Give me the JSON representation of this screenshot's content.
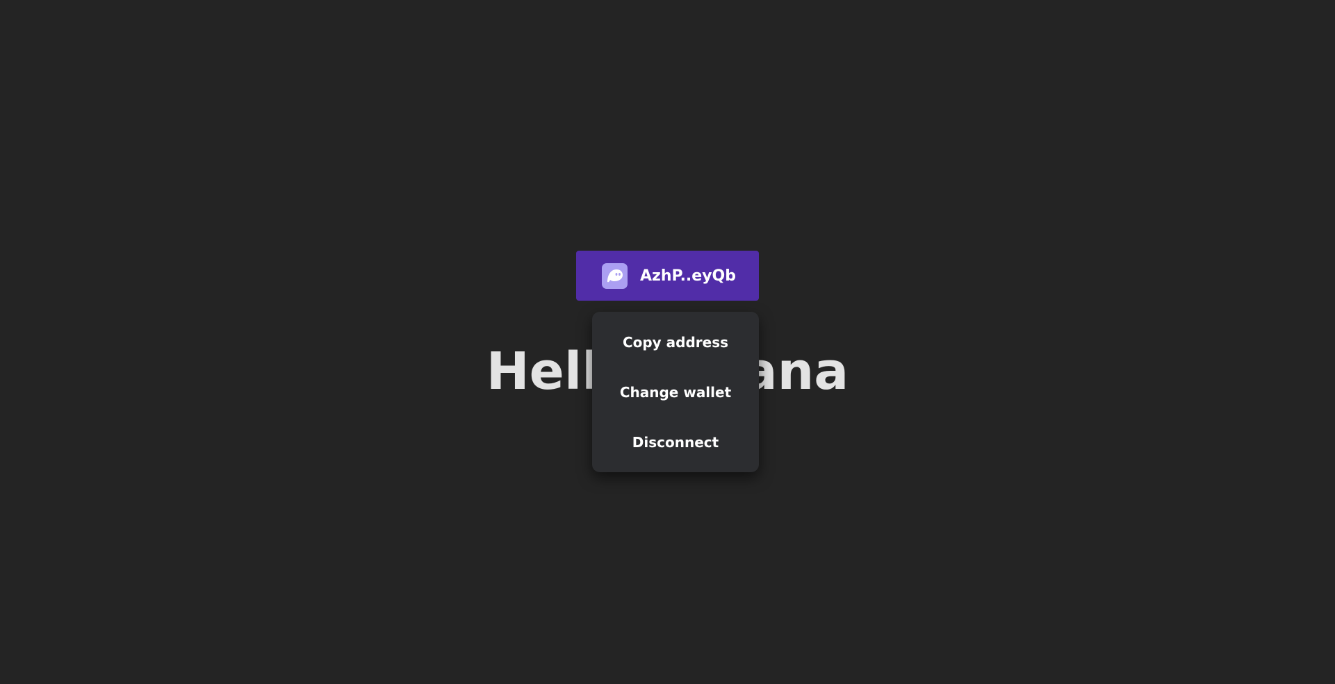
{
  "heading": {
    "text": "Hello Solana"
  },
  "wallet_button": {
    "icon": "phantom-ghost-icon",
    "address": "AzhP..eyQb"
  },
  "dropdown": {
    "items": [
      {
        "label": "Copy address"
      },
      {
        "label": "Change wallet"
      },
      {
        "label": "Disconnect"
      }
    ]
  },
  "colors": {
    "background": "#242424",
    "accent": "#512da8",
    "wallet_icon": "#ab9ff2",
    "dropdown_background": "#2c2d30",
    "heading_text": "#e3e3e3"
  }
}
